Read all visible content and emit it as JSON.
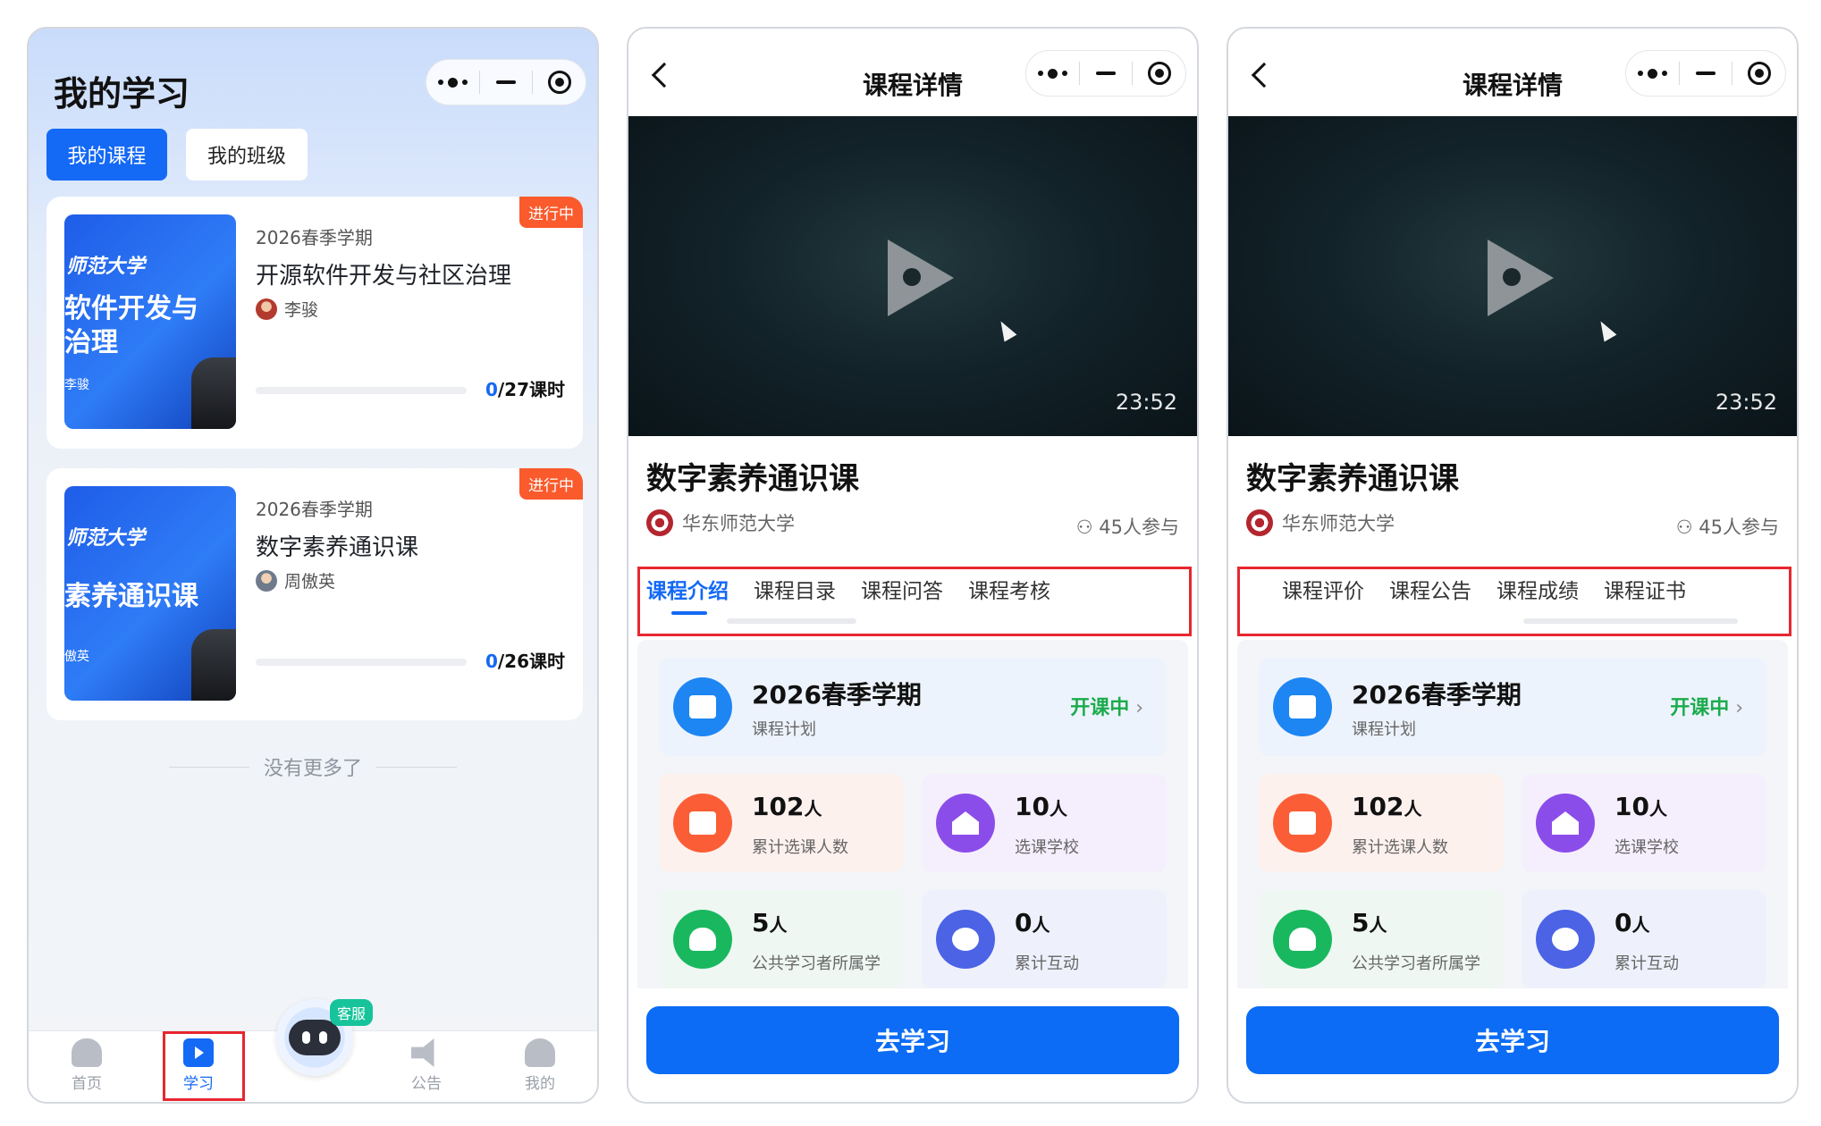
{
  "my_study": {
    "title": "我的学习",
    "segments": [
      "我的课程",
      "我的班级"
    ],
    "courses": [
      {
        "badge": "进行中",
        "term": "2026春季学期",
        "name": "开源软件开发与社区治理",
        "teacher": "李骏",
        "progress_done": "0",
        "progress_total": "/27课时",
        "progress_fraction": 0,
        "cover_school": "师范大学",
        "cover_line1": "软件开发与",
        "cover_line2": "治理",
        "cover_teacher": "李骏"
      },
      {
        "badge": "进行中",
        "term": "2026春季学期",
        "name": "数字素养通识课",
        "teacher": "周傲英",
        "progress_done": "0",
        "progress_total": "/26课时",
        "progress_fraction": 0,
        "cover_school": "师范大学",
        "cover_line1": "素养通识课",
        "cover_teacher": "傲英"
      }
    ],
    "no_more": "没有更多了",
    "tabbar": {
      "home": "首页",
      "study": "学习",
      "kefu": "客服",
      "notice": "公告",
      "me": "我的"
    }
  },
  "detail": {
    "nav_title": "课程详情",
    "duration": "23:52",
    "course_title": "数字素养通识课",
    "school": "华东师范大学",
    "participants": "45人参与",
    "tabs_page1": [
      "课程介绍",
      "课程目录",
      "课程问答",
      "课程考核"
    ],
    "tabs_page2": [
      "课程评价",
      "课程公告",
      "课程成绩",
      "课程证书"
    ],
    "term": {
      "name": "2026春季学期",
      "sub": "课程计划",
      "status": "开课中"
    },
    "stats": [
      {
        "num": "102",
        "unit": "人",
        "label": "累计选课人数",
        "icon": "users-icon"
      },
      {
        "num": "10",
        "unit": "人",
        "label": "选课学校",
        "icon": "school-icon"
      },
      {
        "num": "5",
        "unit": "人",
        "label": "公共学习者所属学",
        "icon": "person-icon"
      },
      {
        "num": "0",
        "unit": "人",
        "label": "累计互动",
        "icon": "chat-icon"
      }
    ],
    "go_button": "去学习"
  },
  "colors": {
    "primary": "#1469f5",
    "badge": "#fa5a2c",
    "status_green": "#1bab4c",
    "highlight_red": "#e8262f"
  }
}
